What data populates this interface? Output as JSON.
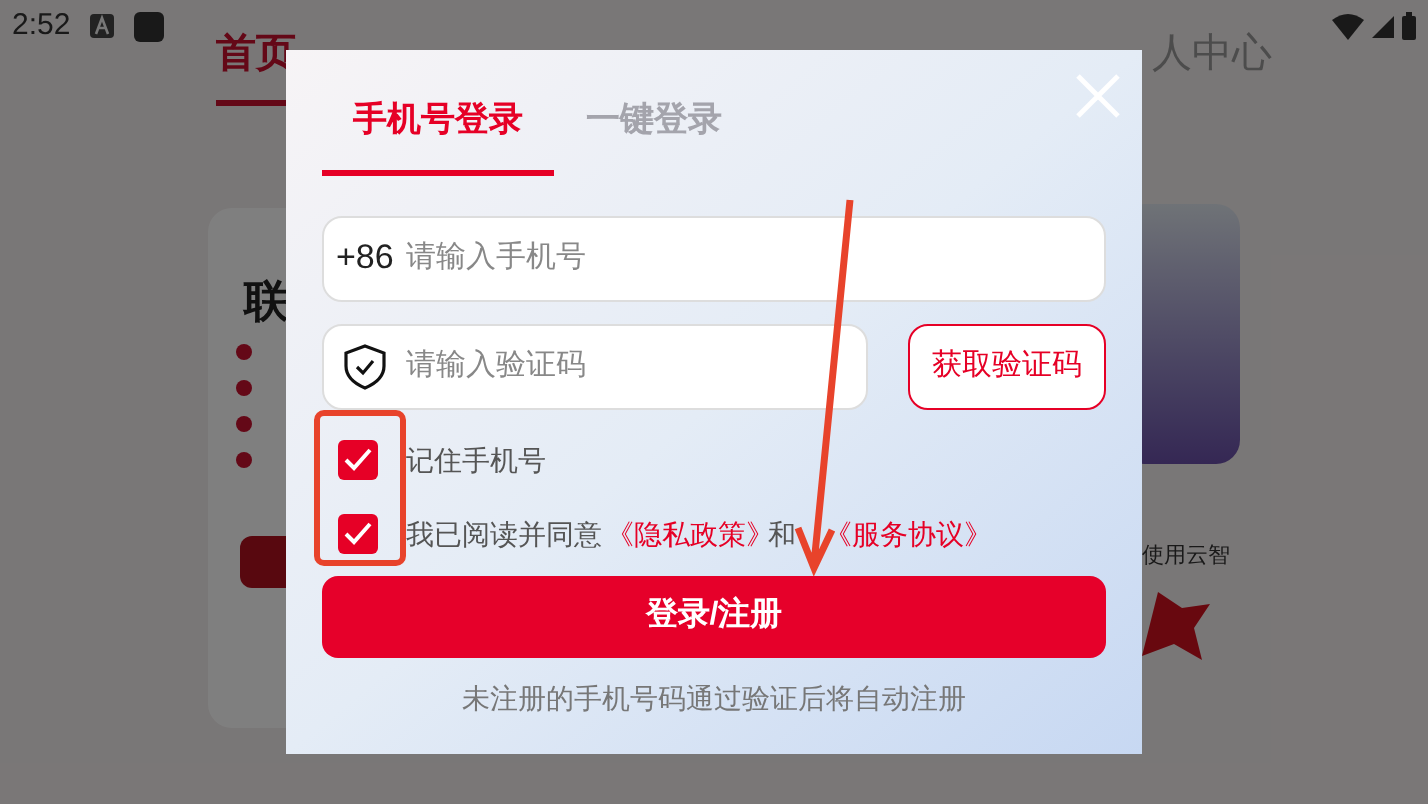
{
  "status_bar": {
    "time": "2:52"
  },
  "app_tabs": [
    {
      "label": "首页",
      "selected": true
    },
    {
      "label": "人中心",
      "selected": false
    }
  ],
  "background_card": {
    "title": "联",
    "side_text": "使用云智"
  },
  "dialog": {
    "tabs": [
      {
        "label": "手机号登录",
        "selected": true
      },
      {
        "label": "一键登录",
        "selected": false
      }
    ],
    "phone_field": {
      "prefix": "+86",
      "placeholder": "请输入手机号"
    },
    "code_field": {
      "placeholder": "请输入验证码"
    },
    "get_code_button": "获取验证码",
    "options": [
      {
        "kind": "remember",
        "checked": true,
        "text": "记住手机号"
      },
      {
        "kind": "agreement",
        "checked": true,
        "text": "我已阅读并同意",
        "links": [
          "《隐私政策》",
          "《服务协议》"
        ],
        "joiner": "和"
      }
    ],
    "submit_button": "登录/注册",
    "footnote": "未注册的手机号码通过验证后将自动注册"
  }
}
